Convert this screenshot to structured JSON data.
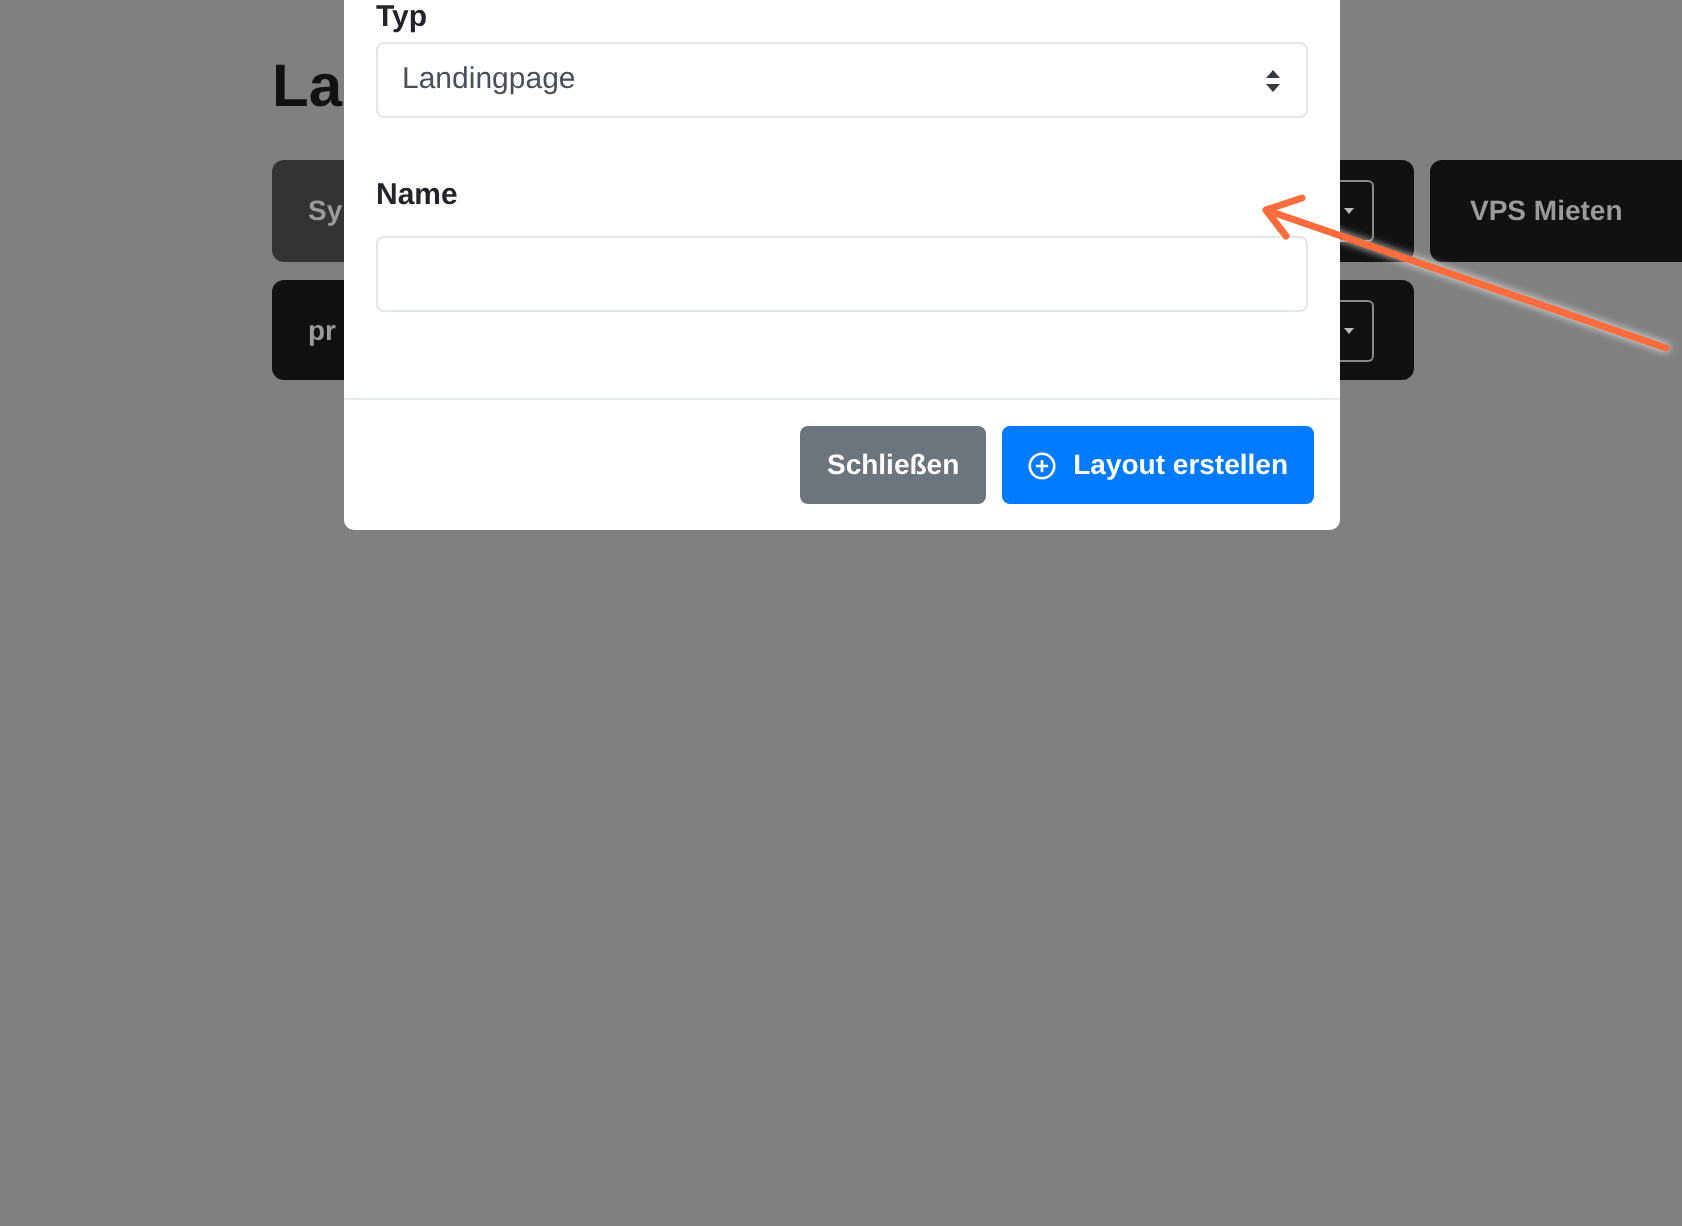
{
  "page": {
    "heading": "La",
    "rows": [
      {
        "cards": [
          {
            "kind": "left_edge",
            "label": "Sy",
            "color": "#333333"
          },
          {
            "kind": "right_edge",
            "color": "#111111"
          },
          {
            "kind": "full",
            "label": "VPS Mieten",
            "color": "#111111"
          }
        ]
      },
      {
        "cards": [
          {
            "kind": "left_edge",
            "label": "pr",
            "color": "#111111"
          },
          {
            "kind": "right_edge",
            "color": "#111111"
          }
        ]
      }
    ]
  },
  "modal": {
    "fields": [
      {
        "kind": "select",
        "label": "Typ",
        "value": "Landingpage"
      },
      {
        "kind": "text",
        "label": "Name"
      }
    ],
    "buttons": [
      {
        "kind": "secondary",
        "label": "Schließen"
      },
      {
        "kind": "primary",
        "label": "Layout erstellen"
      }
    ]
  },
  "annotations": [
    {
      "kind": "arrow"
    }
  ]
}
